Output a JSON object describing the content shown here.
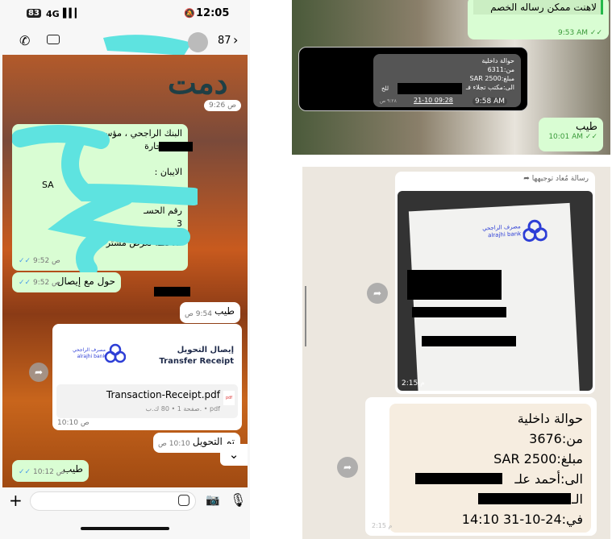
{
  "panel_a": {
    "status": {
      "battery": "83",
      "network": "4G",
      "time": "12:05"
    },
    "header": {
      "count": "87",
      "icons": [
        "phone-icon",
        "video-icon",
        "avatar-icon",
        "chevron-right-icon"
      ]
    },
    "logo_text": "دمت",
    "messages": [
      {
        "time": "9:26 ص"
      },
      {
        "lines": [
          "البنك الراجحي ، مؤسسـ",
          "ـل للتجارة",
          "",
          "الايبان :",
          "SA",
          "",
          "رقم الحسـ",
          "3",
          "",
          "ملاحظة لغرض مشتر"
        ],
        "time": "9:52 ص"
      },
      {
        "text": "حول مع إيصال",
        "time": "9:52 ص"
      },
      {
        "text": "طيب",
        "time": "9:54 ص"
      },
      {
        "receipt_title_ar": "إيصال التحويل",
        "receipt_title_en": "Transfer Receipt",
        "bank_ar": "مصرف الراجحي",
        "bank_en": "alrajhi bank",
        "file_name": "Transaction-Receipt.pdf",
        "file_meta": "صفحة 1 • 80 ك.ب. • pdf",
        "file_icon": "pdf",
        "time": "10:10 ص"
      },
      {
        "text": "تم التحويل",
        "time": "10:10 ص"
      },
      {
        "text": "طيب",
        "time": "10:12 ص"
      }
    ],
    "input": {
      "placeholder": ""
    }
  },
  "panel_b": {
    "messages": [
      {
        "text": "لاهنت ممكن رساله الخصم",
        "time": "9:53 AM"
      },
      {
        "lines": [
          "حوالة داخلية",
          "من:6311",
          "مبلغ:SAR 2500",
          "الى:مكتب تجلاء فـ",
          "للخ"
        ],
        "date": "09:28 21-10",
        "inner_time": "٩:٢٨ ص",
        "time": "9:58 AM"
      },
      {
        "text": "طيب",
        "time": "10:01 AM"
      }
    ]
  },
  "panel_c": {
    "forwarded_label": "رسالة مُعاد توجيهها",
    "image_time": "2:15 م",
    "bank_ar": "مصرف الراجحي",
    "bank_en": "alrajhi bank",
    "message": {
      "lines": [
        "حوالة داخلية",
        "من:3676",
        "مبلغ:SAR 2500",
        "الى:أحمد علـ",
        "الـ",
        "في:24-10-31 14:10"
      ],
      "time": "2:15 م"
    }
  },
  "colors": {
    "outgoing": "#d9fdd3",
    "redaction_scribble": "#5ee3e0",
    "bank_blue": "#2d3ed6"
  }
}
